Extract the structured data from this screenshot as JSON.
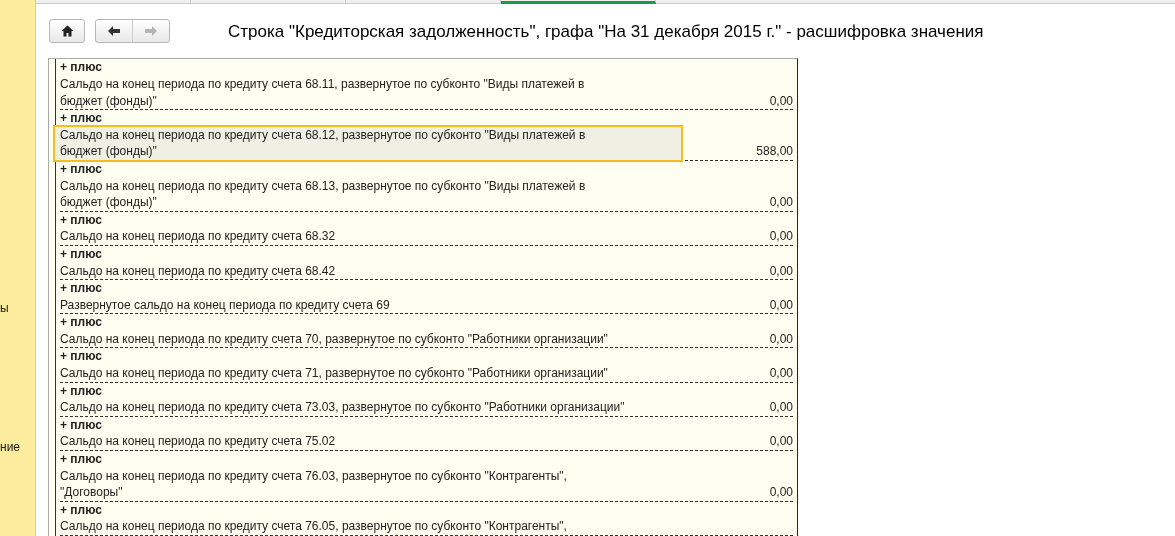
{
  "sidebar": {
    "items": [
      "ы",
      "ние"
    ]
  },
  "top_tabs": [
    {
      "selected": false
    },
    {
      "selected": false
    },
    {
      "selected": false
    },
    {
      "selected": true
    }
  ],
  "toolbar": {
    "back": {
      "disabled": false
    },
    "forward": {
      "disabled": true
    }
  },
  "title": "Строка \"Кредиторская задолженность\", графа \"На 31 декабря 2015 г.\" - расшифровка значения",
  "entries": [
    {
      "sign": "+ плюс",
      "lines": [
        "Сальдо на конец периода по кредиту счета 68.11, развернутое по субконто \"Виды платежей в",
        "бюджет (фонды)\""
      ],
      "value": "0,00",
      "selected": false
    },
    {
      "sign": "+ плюс",
      "lines": [
        "Сальдо на конец периода по кредиту счета 68.12, развернутое по субконто \"Виды платежей в",
        "бюджет (фонды)\""
      ],
      "value": "588,00",
      "selected": true
    },
    {
      "sign": "+ плюс",
      "lines": [
        "Сальдо на конец периода по кредиту счета 68.13, развернутое по субконто \"Виды платежей в",
        "бюджет (фонды)\""
      ],
      "value": "0,00",
      "selected": false
    },
    {
      "sign": "+ плюс",
      "lines": [
        "Сальдо на конец периода по кредиту счета 68.32"
      ],
      "value": "0,00",
      "selected": false
    },
    {
      "sign": "+ плюс",
      "lines": [
        "Сальдо на конец периода по кредиту счета 68.42"
      ],
      "value": "0,00",
      "selected": false
    },
    {
      "sign": "+ плюс",
      "lines": [
        "Развернутое сальдо на конец периода по кредиту счета 69"
      ],
      "value": "0,00",
      "selected": false
    },
    {
      "sign": "+ плюс",
      "lines": [
        "Сальдо на конец периода по кредиту счета 70, развернутое по субконто \"Работники организации\""
      ],
      "value": "0,00",
      "selected": false
    },
    {
      "sign": "+ плюс",
      "lines": [
        "Сальдо на конец периода по кредиту счета 71, развернутое по субконто \"Работники организации\""
      ],
      "value": "0,00",
      "selected": false
    },
    {
      "sign": "+ плюс",
      "lines": [
        "Сальдо на конец периода по кредиту счета 73.03, развернутое по субконто \"Работники организации\""
      ],
      "value": "0,00",
      "selected": false
    },
    {
      "sign": "+ плюс",
      "lines": [
        "Сальдо на конец периода по кредиту счета 75.02"
      ],
      "value": "0,00",
      "selected": false
    },
    {
      "sign": "+ плюс",
      "lines": [
        "Сальдо на конец периода по кредиту счета 76.03, развернутое по субконто \"Контрагенты\",",
        "\"Договоры\""
      ],
      "value": "0,00",
      "selected": false
    },
    {
      "sign": "+ плюс",
      "lines": [
        "Сальдо на конец периода по кредиту счета 76.05, развернутое по субконто \"Контрагенты\","
      ],
      "selected": false
    }
  ]
}
